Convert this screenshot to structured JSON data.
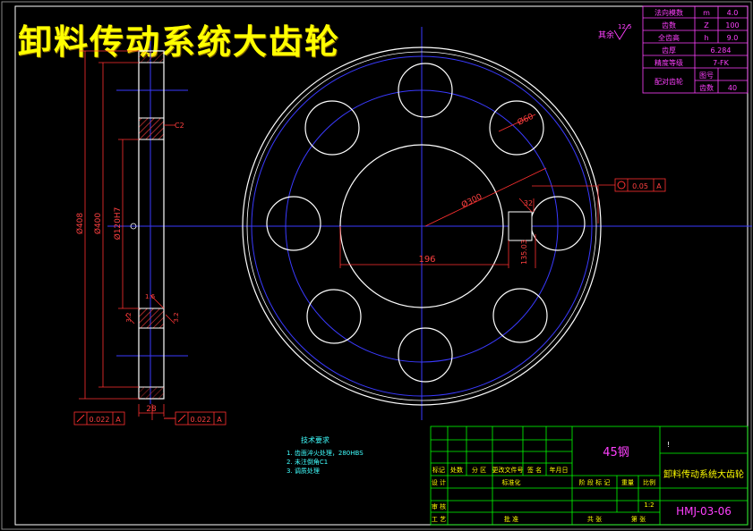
{
  "title": "卸料传动系统大齿轮",
  "gear_params": [
    {
      "label": "法向模数",
      "symbol": "m",
      "value": "4.0"
    },
    {
      "label": "齿数",
      "symbol": "Z",
      "value": "100"
    },
    {
      "label": "全齿高",
      "symbol": "h",
      "value": "9.0"
    },
    {
      "label": "齿厚",
      "symbol": "",
      "value": "6.284"
    },
    {
      "label": "精度等级",
      "symbol": "",
      "value": "7-FK"
    }
  ],
  "mating": {
    "label": "配对齿轮",
    "r1": "图号",
    "r2": "齿数",
    "r2_value": "40"
  },
  "roughness": {
    "other": "其余",
    "value": "12.5"
  },
  "dimensions": {
    "d_outer": "Ø408",
    "d_400": "Ø400",
    "d_bore_fit": "Ø120H7",
    "chamfer": "C2",
    "hole_dia": "Ø60",
    "pcd": "Ø300",
    "bore_dim": "196",
    "keyway_w": "32",
    "keyway_depth": "135.03",
    "thickness": "28",
    "r_left": "3.2",
    "r_right": "3.2",
    "fine": "1.6"
  },
  "tolerances": {
    "right": {
      "value": "0.05",
      "datum": "A"
    },
    "left": {
      "value": "0.022",
      "datum": "A"
    },
    "mid": {
      "value": "0.022",
      "datum": "A"
    }
  },
  "tech_req": {
    "title": "技术要求",
    "items": [
      "1. 齿面淬火处理，280HBS",
      "2. 未注倒角C1",
      "3. 调质处理"
    ]
  },
  "title_block": {
    "material": "45钢",
    "part_name": "卸料传动系统大齿轮",
    "drawing_no": "HMJ-03-06",
    "rev_headers": [
      "标记",
      "处数",
      "分 区",
      "更改文件号",
      "签 名",
      "年月日"
    ],
    "row_design": "设 计",
    "row_standard": "标准化",
    "row_review": "审 核",
    "row_process": "工 艺",
    "row_approve": "批 准",
    "stage_headers": [
      "阶 段 标 记",
      "重量",
      "比例"
    ],
    "scale": "1:2",
    "sheet_total": "共 张",
    "sheet_no": "第 张",
    "mark": "!"
  }
}
